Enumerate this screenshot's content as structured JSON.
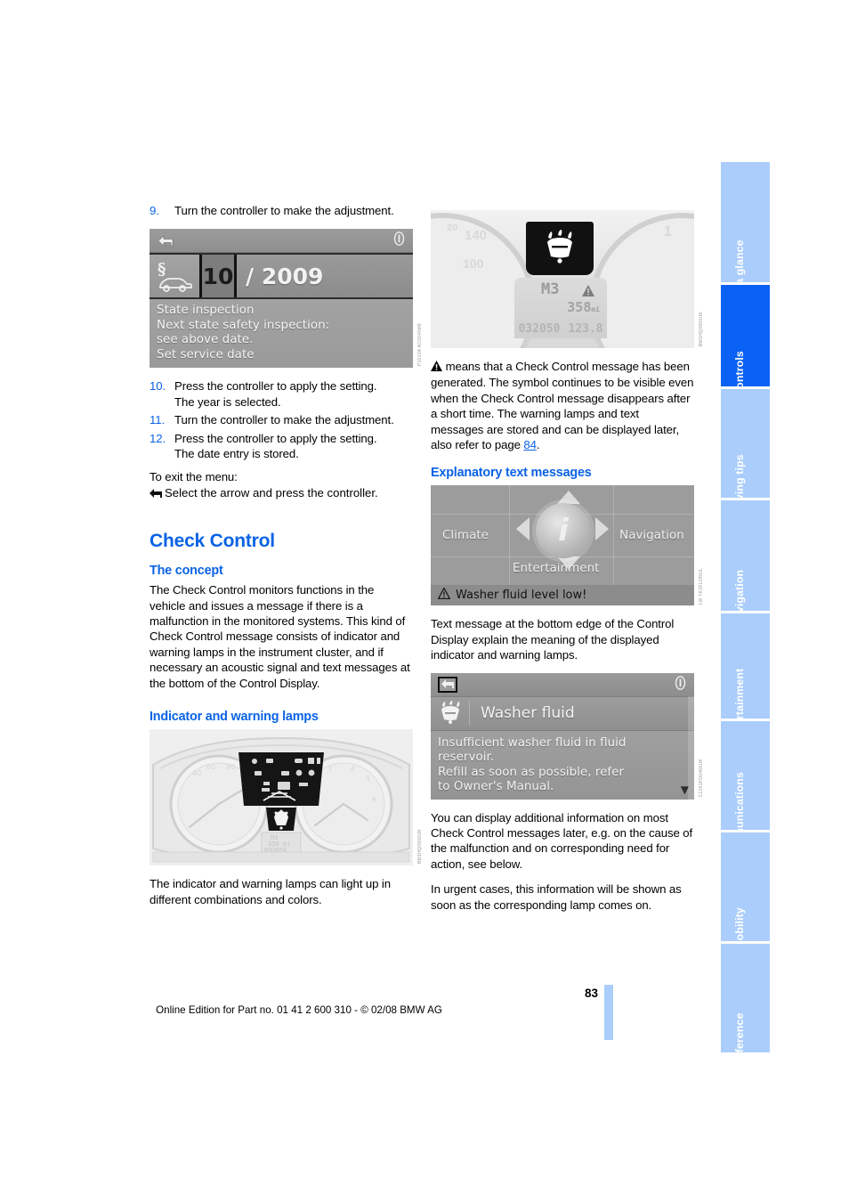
{
  "page": {
    "number": "83",
    "footer_note": "Online Edition for Part no. 01 41 2 600 310 - © 02/08 BMW AG"
  },
  "sidebar": {
    "tabs": [
      {
        "label": "At a glance",
        "active": false
      },
      {
        "label": "Controls",
        "active": true
      },
      {
        "label": "Driving tips",
        "active": false
      },
      {
        "label": "Navigation",
        "active": false
      },
      {
        "label": "Entertainment",
        "active": false
      },
      {
        "label": "Communications",
        "active": false
      },
      {
        "label": "Mobility",
        "active": false
      },
      {
        "label": "Reference",
        "active": false
      }
    ],
    "active_color": "#0a62f4",
    "inactive_color": "#aacdfb"
  },
  "left_column": {
    "step9": {
      "num": "9.",
      "text": "Turn the controller to make the adjustment."
    },
    "figure_service_date": {
      "month": "10",
      "year": "/ 2009",
      "lines": [
        "State inspection",
        "Next state safety inspection:",
        "see above date.",
        "Set service date"
      ],
      "code": "P1010A AC0045M8"
    },
    "step10": {
      "num": "10.",
      "text": "Press the controller to apply the setting.",
      "sub": "The year is selected."
    },
    "step11": {
      "num": "11.",
      "text": "Turn the controller to make the adjustment."
    },
    "step12": {
      "num": "12.",
      "text": "Press the controller to apply the setting.",
      "sub": "The date entry is stored."
    },
    "exit_lead": "To exit the menu:",
    "exit_action": "Select the arrow and press the controller.",
    "heading_check_control": "Check Control",
    "heading_the_concept": "The concept",
    "concept_paragraph": "The Check Control monitors functions in the vehicle and issues a message if there is a malfunction in the monitored systems. This kind of Check Control message consists of indicator and warning lamps in the instrument cluster, and if necessary an acoustic signal and text messages at the bottom of the Control Display.",
    "heading_indicator_lamps": "Indicator and warning lamps",
    "figure_cluster": {
      "code": "BM1HQ0900UK"
    },
    "lamps_paragraph": "The indicator and warning lamps can light up in different combinations and colors."
  },
  "right_column": {
    "figure_cluster_zoom": {
      "gear": "M3",
      "range": "358",
      "range_unit": "mi",
      "odometer": "032050",
      "trip": "123.8",
      "tick_left_top": "20",
      "tick_left_mid": "140",
      "tick_left_low": "100",
      "tick_right": "1",
      "code": "BM1HQ0900UK"
    },
    "warning_paragraph_prefix": "means that a Check Control message has been generated. The symbol continues to be visible even when the Check Control message disappears after a short time. The warning lamps and text messages are stored and can be displayed later, also refer to page ",
    "warning_paragraph_link": "84",
    "warning_paragraph_suffix": ".",
    "heading_explanatory": "Explanatory text messages",
    "figure_idrive": {
      "climate": "Climate",
      "navigation": "Navigation",
      "entertainment": "Entertainment",
      "info_glyph": "i",
      "status_message": "Washer fluid level low!",
      "code": "LW TK3FLORUL"
    },
    "text_message_paragraph": "Text message at the bottom edge of the Control Display explain the meaning of the displayed indicator and warning lamps.",
    "figure_washer_message": {
      "title": "Washer fluid",
      "lines": [
        "Insufficient washer fluid in fluid",
        "reservoir.",
        "Refill as soon as possible, refer",
        "to Owner's Manual."
      ],
      "code": "C1261FD0466UK"
    },
    "additional_info_paragraph": "You can display additional information on most Check Control messages later, e.g. on the cause of the malfunction and on corresponding need for action, see below.",
    "urgent_paragraph": "In urgent cases, this information will be shown as soon as the corresponding lamp comes on."
  }
}
